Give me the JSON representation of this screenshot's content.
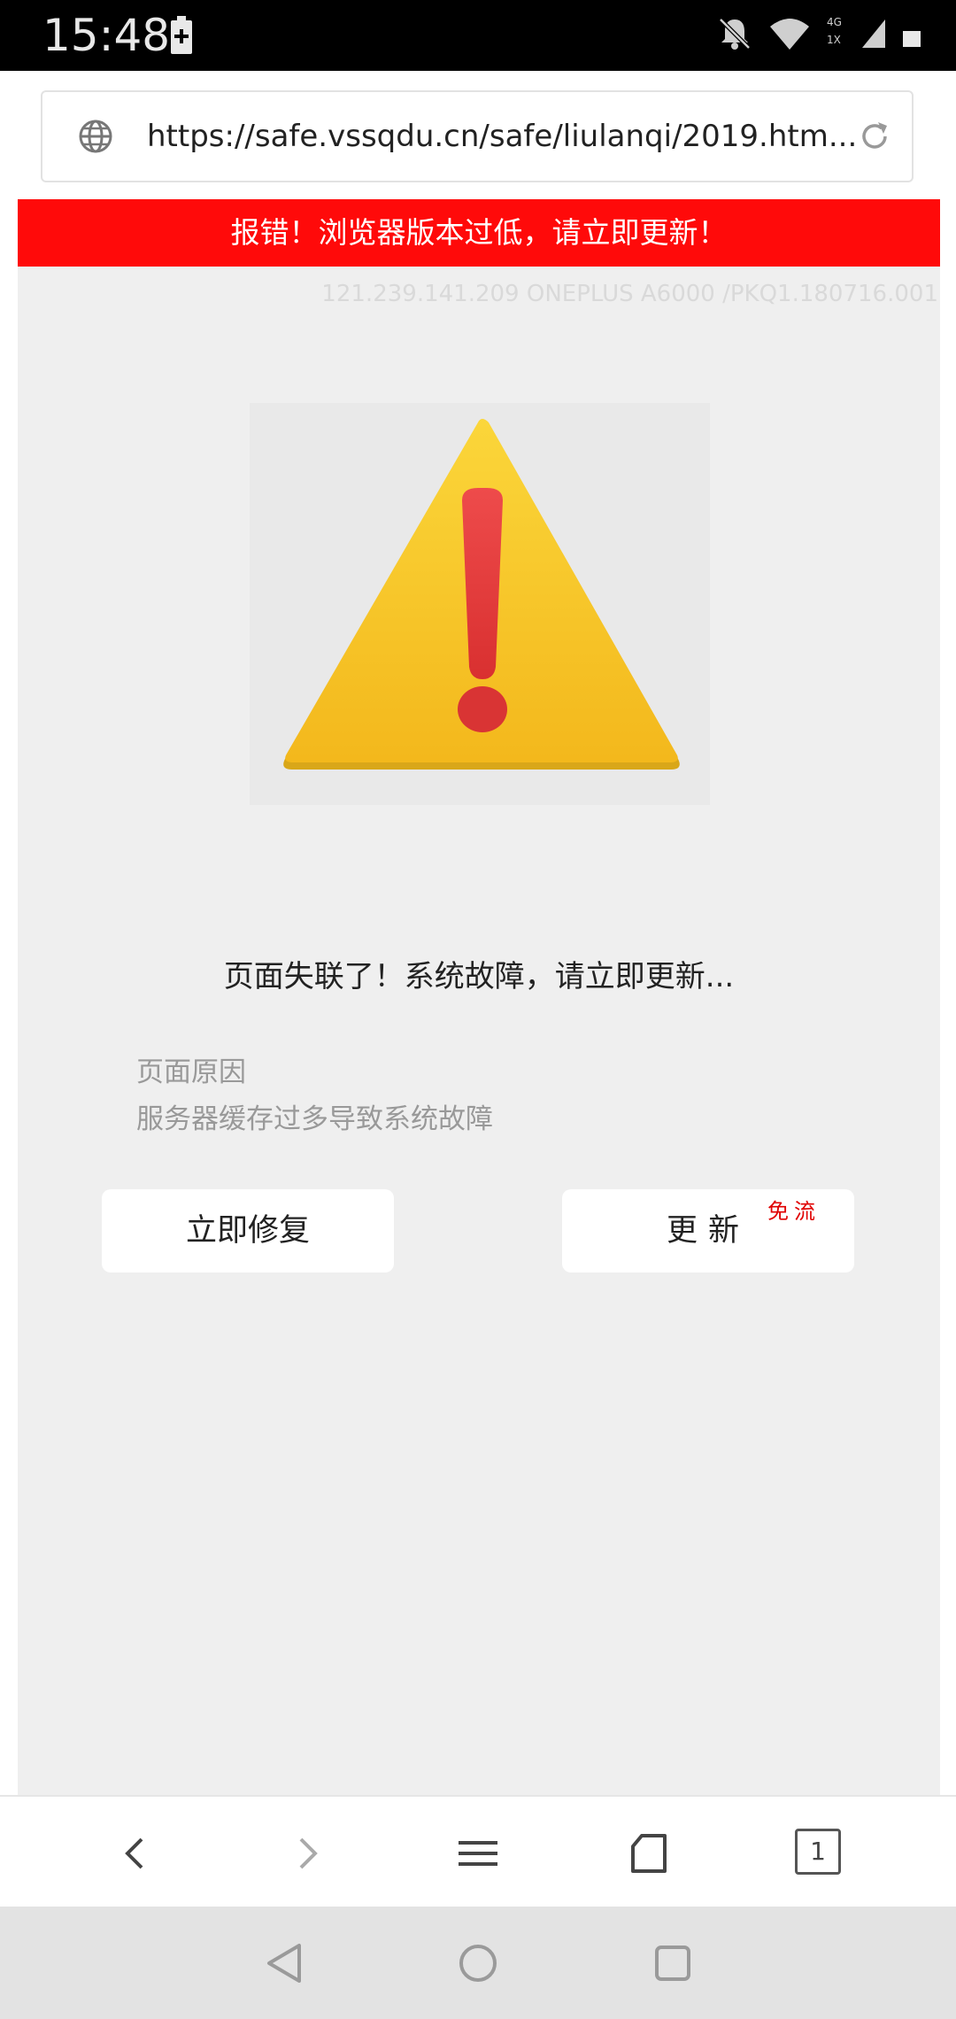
{
  "status_bar": {
    "time": "15:48",
    "network_top": "4G",
    "network_bottom": "1X"
  },
  "address_bar": {
    "url": "https://safe.vssqdu.cn/safe/liulanqi/2019.htm..."
  },
  "page": {
    "alert_banner": "报错！浏览器版本过低，请立即更新！",
    "device_info": "121.239.141.209 ONEPLUS A6000 /PKQ1.180716.001",
    "headline": "页面失联了！系统故障，请立即更新...",
    "reason_label": "页面原因",
    "reason_text": "服务器缓存过多导致系统故障",
    "fix_button": "立即修复",
    "update_button": "更新",
    "update_badge": "免流"
  },
  "browser_toolbar": {
    "tabs_count": "1"
  },
  "icons": {
    "status_battery": "battery-charging-icon",
    "status_mute": "bell-off-icon",
    "status_wifi": "wifi-icon",
    "status_signal": "signal-icon",
    "status_battery_right": "battery-icon",
    "globe": "globe-icon",
    "reload": "reload-icon",
    "warning": "warning-triangle-icon",
    "back": "chevron-left-icon",
    "forward": "chevron-right-icon",
    "menu": "menu-icon",
    "home": "home-icon",
    "nav_back": "triangle-back-icon",
    "nav_home": "circle-home-icon",
    "nav_recent": "square-recent-icon"
  },
  "colors": {
    "banner": "#ff0a0a",
    "badge": "#e00000",
    "warning_yellow": "#f7c21f",
    "warning_red": "#e23b3b",
    "page_bg": "#efefef"
  }
}
